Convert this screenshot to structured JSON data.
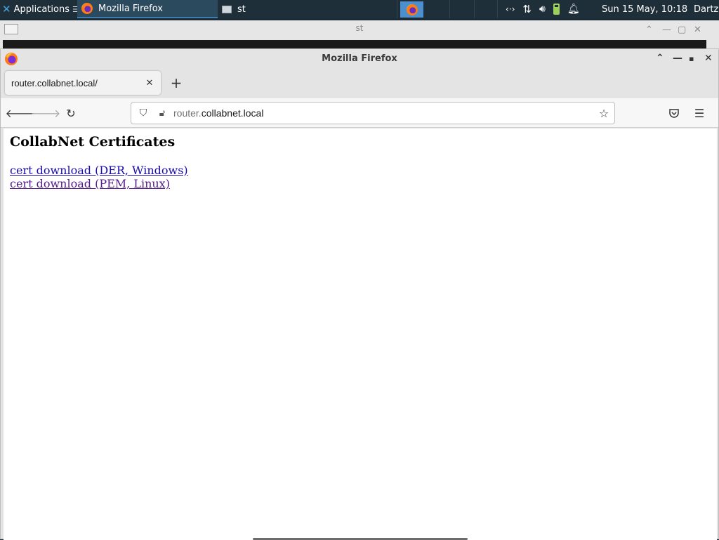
{
  "panel": {
    "apps_label": "Applications",
    "tasks": [
      {
        "label": "Mozilla Firefox"
      },
      {
        "label": "st"
      }
    ],
    "clock": "Sun 15 May, 10:18",
    "user": "Dartz"
  },
  "st_window": {
    "title": "st"
  },
  "firefox": {
    "window_title": "Mozilla Firefox",
    "tab": {
      "label": "router.collabnet.local/"
    },
    "url": {
      "prefix": "router.",
      "domain": "collabnet.local"
    },
    "page": {
      "heading": "CollabNet Certificates",
      "links": [
        {
          "label": "cert download (DER, Windows)"
        },
        {
          "label": "cert download (PEM, Linux)"
        }
      ]
    }
  }
}
